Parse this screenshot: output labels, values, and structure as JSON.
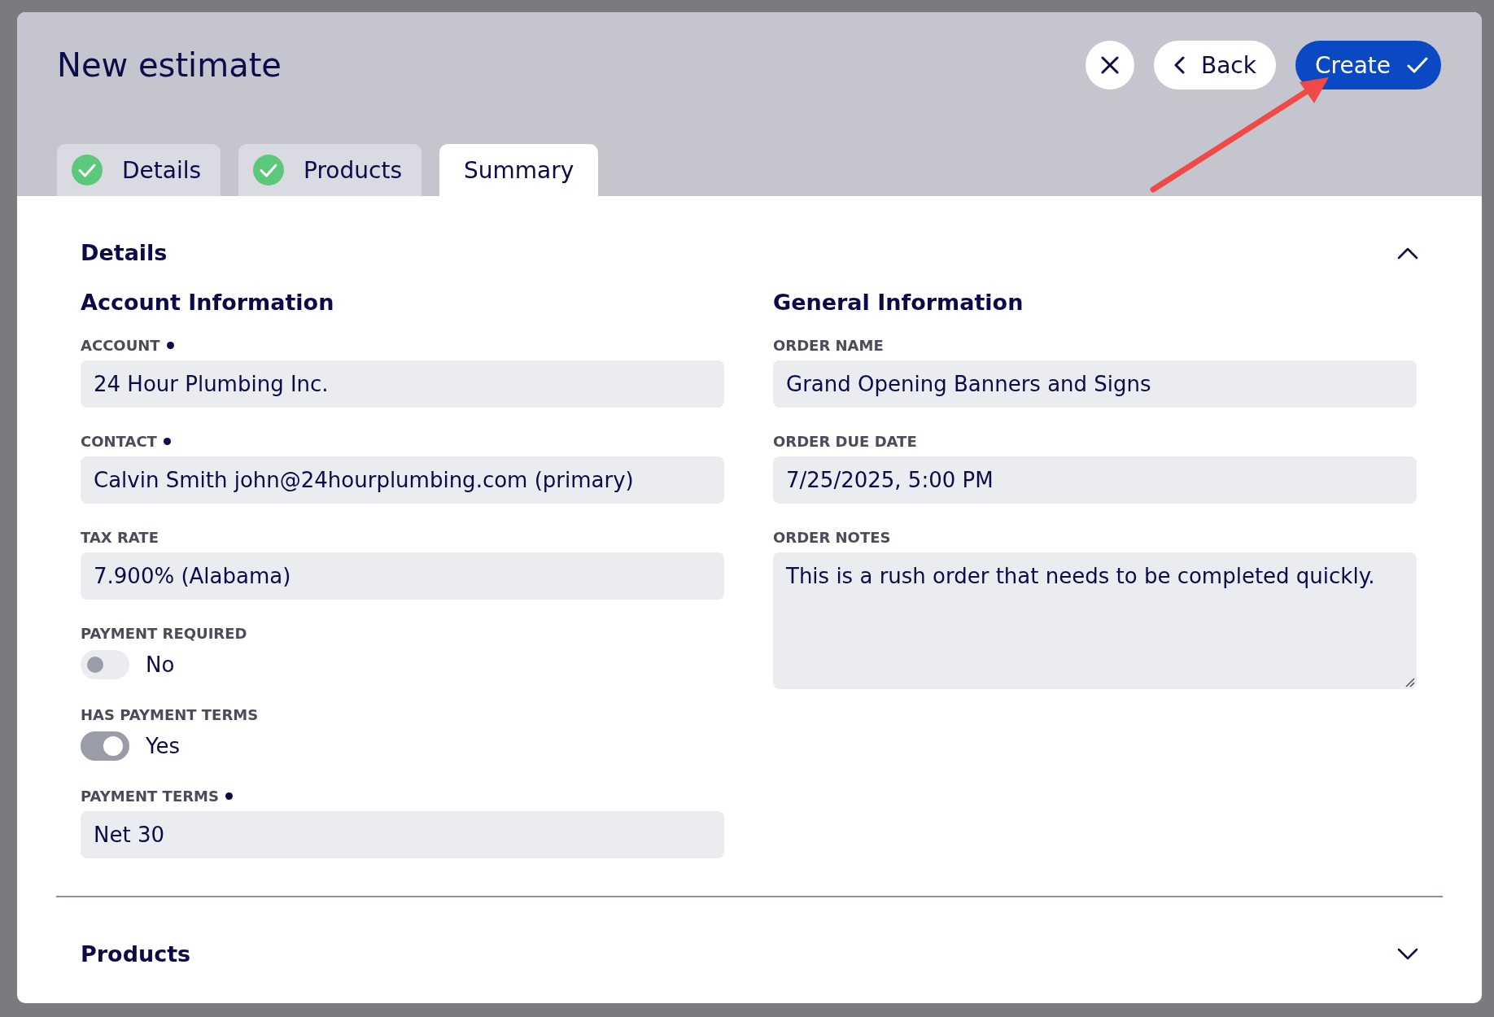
{
  "window": {
    "title": "New estimate"
  },
  "actions": [
    {
      "kind": "close"
    },
    {
      "kind": "back",
      "label": "Back"
    },
    {
      "kind": "create",
      "label": "Create"
    }
  ],
  "tabs": [
    {
      "label": "Details",
      "completed": true,
      "selected": false
    },
    {
      "label": "Products",
      "completed": true,
      "selected": false
    },
    {
      "label": "Summary",
      "completed": false,
      "selected": true
    }
  ],
  "sections": [
    {
      "title": "Details",
      "expanded": true,
      "columns": [
        {
          "heading": "Account Information",
          "fields": [
            {
              "kind": "input",
              "label": "ACCOUNT",
              "required": true,
              "value": "24 Hour Plumbing Inc."
            },
            {
              "kind": "input",
              "label": "CONTACT",
              "required": true,
              "value": "Calvin Smith john@24hourplumbing.com (primary)"
            },
            {
              "kind": "input",
              "label": "TAX RATE",
              "required": false,
              "value": "7.900% (Alabama)"
            },
            {
              "kind": "toggle",
              "label": "PAYMENT REQUIRED",
              "on": false,
              "value": "No"
            },
            {
              "kind": "toggle",
              "label": "HAS PAYMENT TERMS",
              "on": true,
              "value": "Yes"
            },
            {
              "kind": "input",
              "label": "PAYMENT TERMS",
              "required": true,
              "value": "Net 30"
            }
          ]
        },
        {
          "heading": "General Information",
          "fields": [
            {
              "kind": "input",
              "label": "ORDER NAME",
              "required": false,
              "value": "Grand Opening Banners and Signs"
            },
            {
              "kind": "input",
              "label": "ORDER DUE DATE",
              "required": false,
              "value": "7/25/2025, 5:00 PM"
            },
            {
              "kind": "textarea",
              "label": "ORDER NOTES",
              "required": false,
              "value": "This is a rush order that needs to be completed quickly."
            }
          ]
        }
      ]
    },
    {
      "title": "Products",
      "expanded": false
    }
  ]
}
